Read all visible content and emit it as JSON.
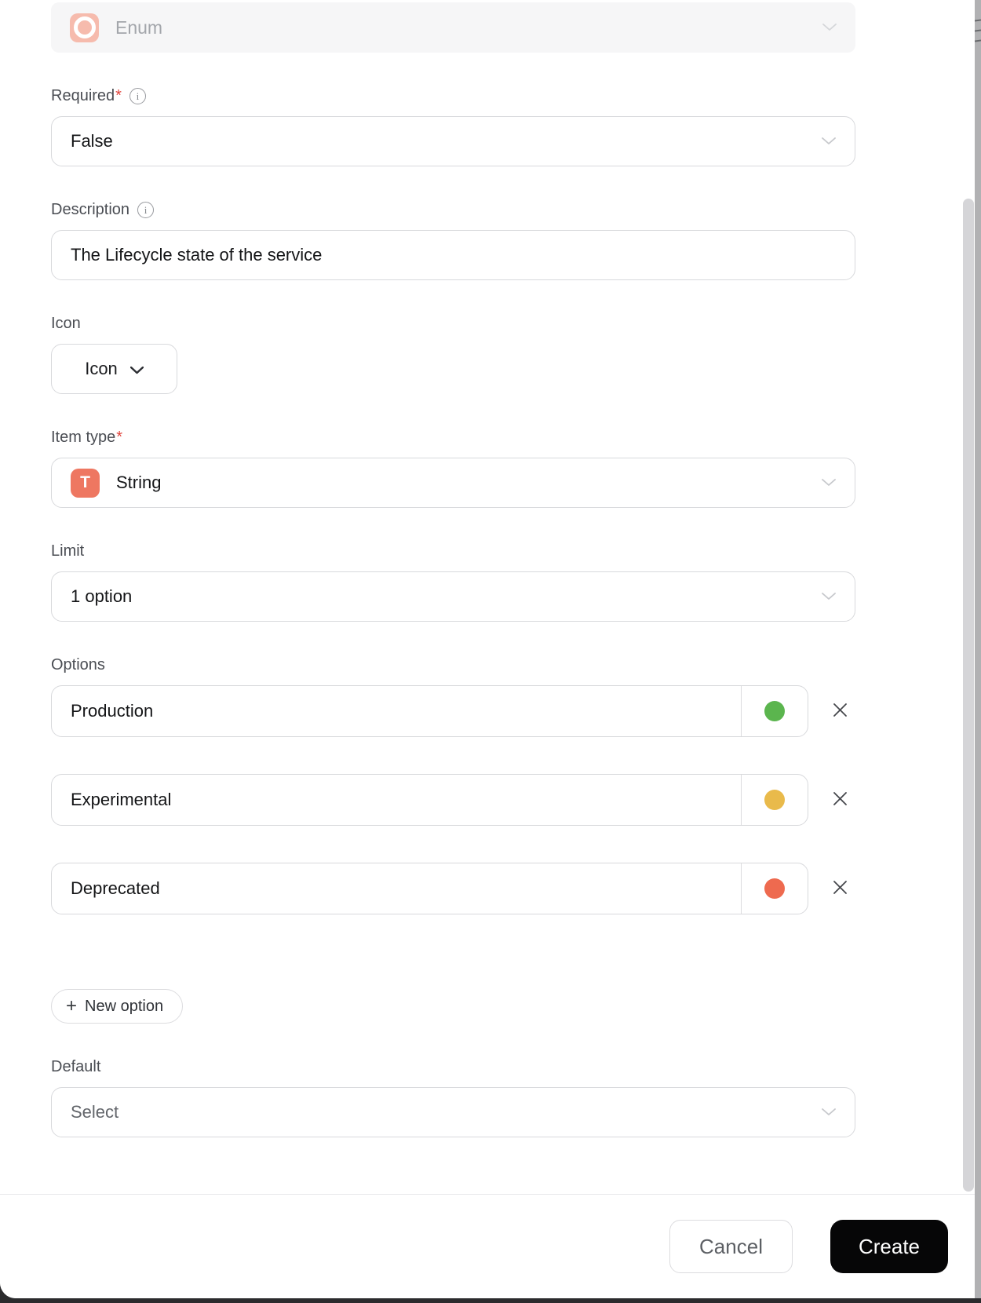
{
  "colors": {
    "enum_badge_bg": "#f6bbad",
    "type_badge_bg": "#ee7761",
    "required_asterisk": "#e0443c",
    "create_button_bg": "#060607",
    "dot_green": "#5bb54e",
    "dot_yellow": "#e9ba4b",
    "dot_red": "#ee6a4f"
  },
  "icons": {
    "info_glyph": "i",
    "plus_glyph": "+"
  },
  "form": {
    "type_select": {
      "value": "Enum"
    },
    "required": {
      "label": "Required",
      "required_mark": "*",
      "value": "False"
    },
    "description": {
      "label": "Description",
      "value": "The Lifecycle state of the service"
    },
    "icon": {
      "label": "Icon",
      "button_label": "Icon"
    },
    "item_type": {
      "label": "Item type",
      "required_mark": "*",
      "badge_letter": "T",
      "value": "String"
    },
    "limit": {
      "label": "Limit",
      "value": "1 option"
    },
    "options": {
      "label": "Options",
      "items": [
        {
          "value": "Production",
          "color": "#5bb54e"
        },
        {
          "value": "Experimental",
          "color": "#e9ba4b"
        },
        {
          "value": "Deprecated",
          "color": "#ee6a4f"
        }
      ],
      "new_option_label": "New option"
    },
    "default": {
      "label": "Default",
      "placeholder": "Select"
    }
  },
  "footer": {
    "cancel_label": "Cancel",
    "create_label": "Create"
  }
}
